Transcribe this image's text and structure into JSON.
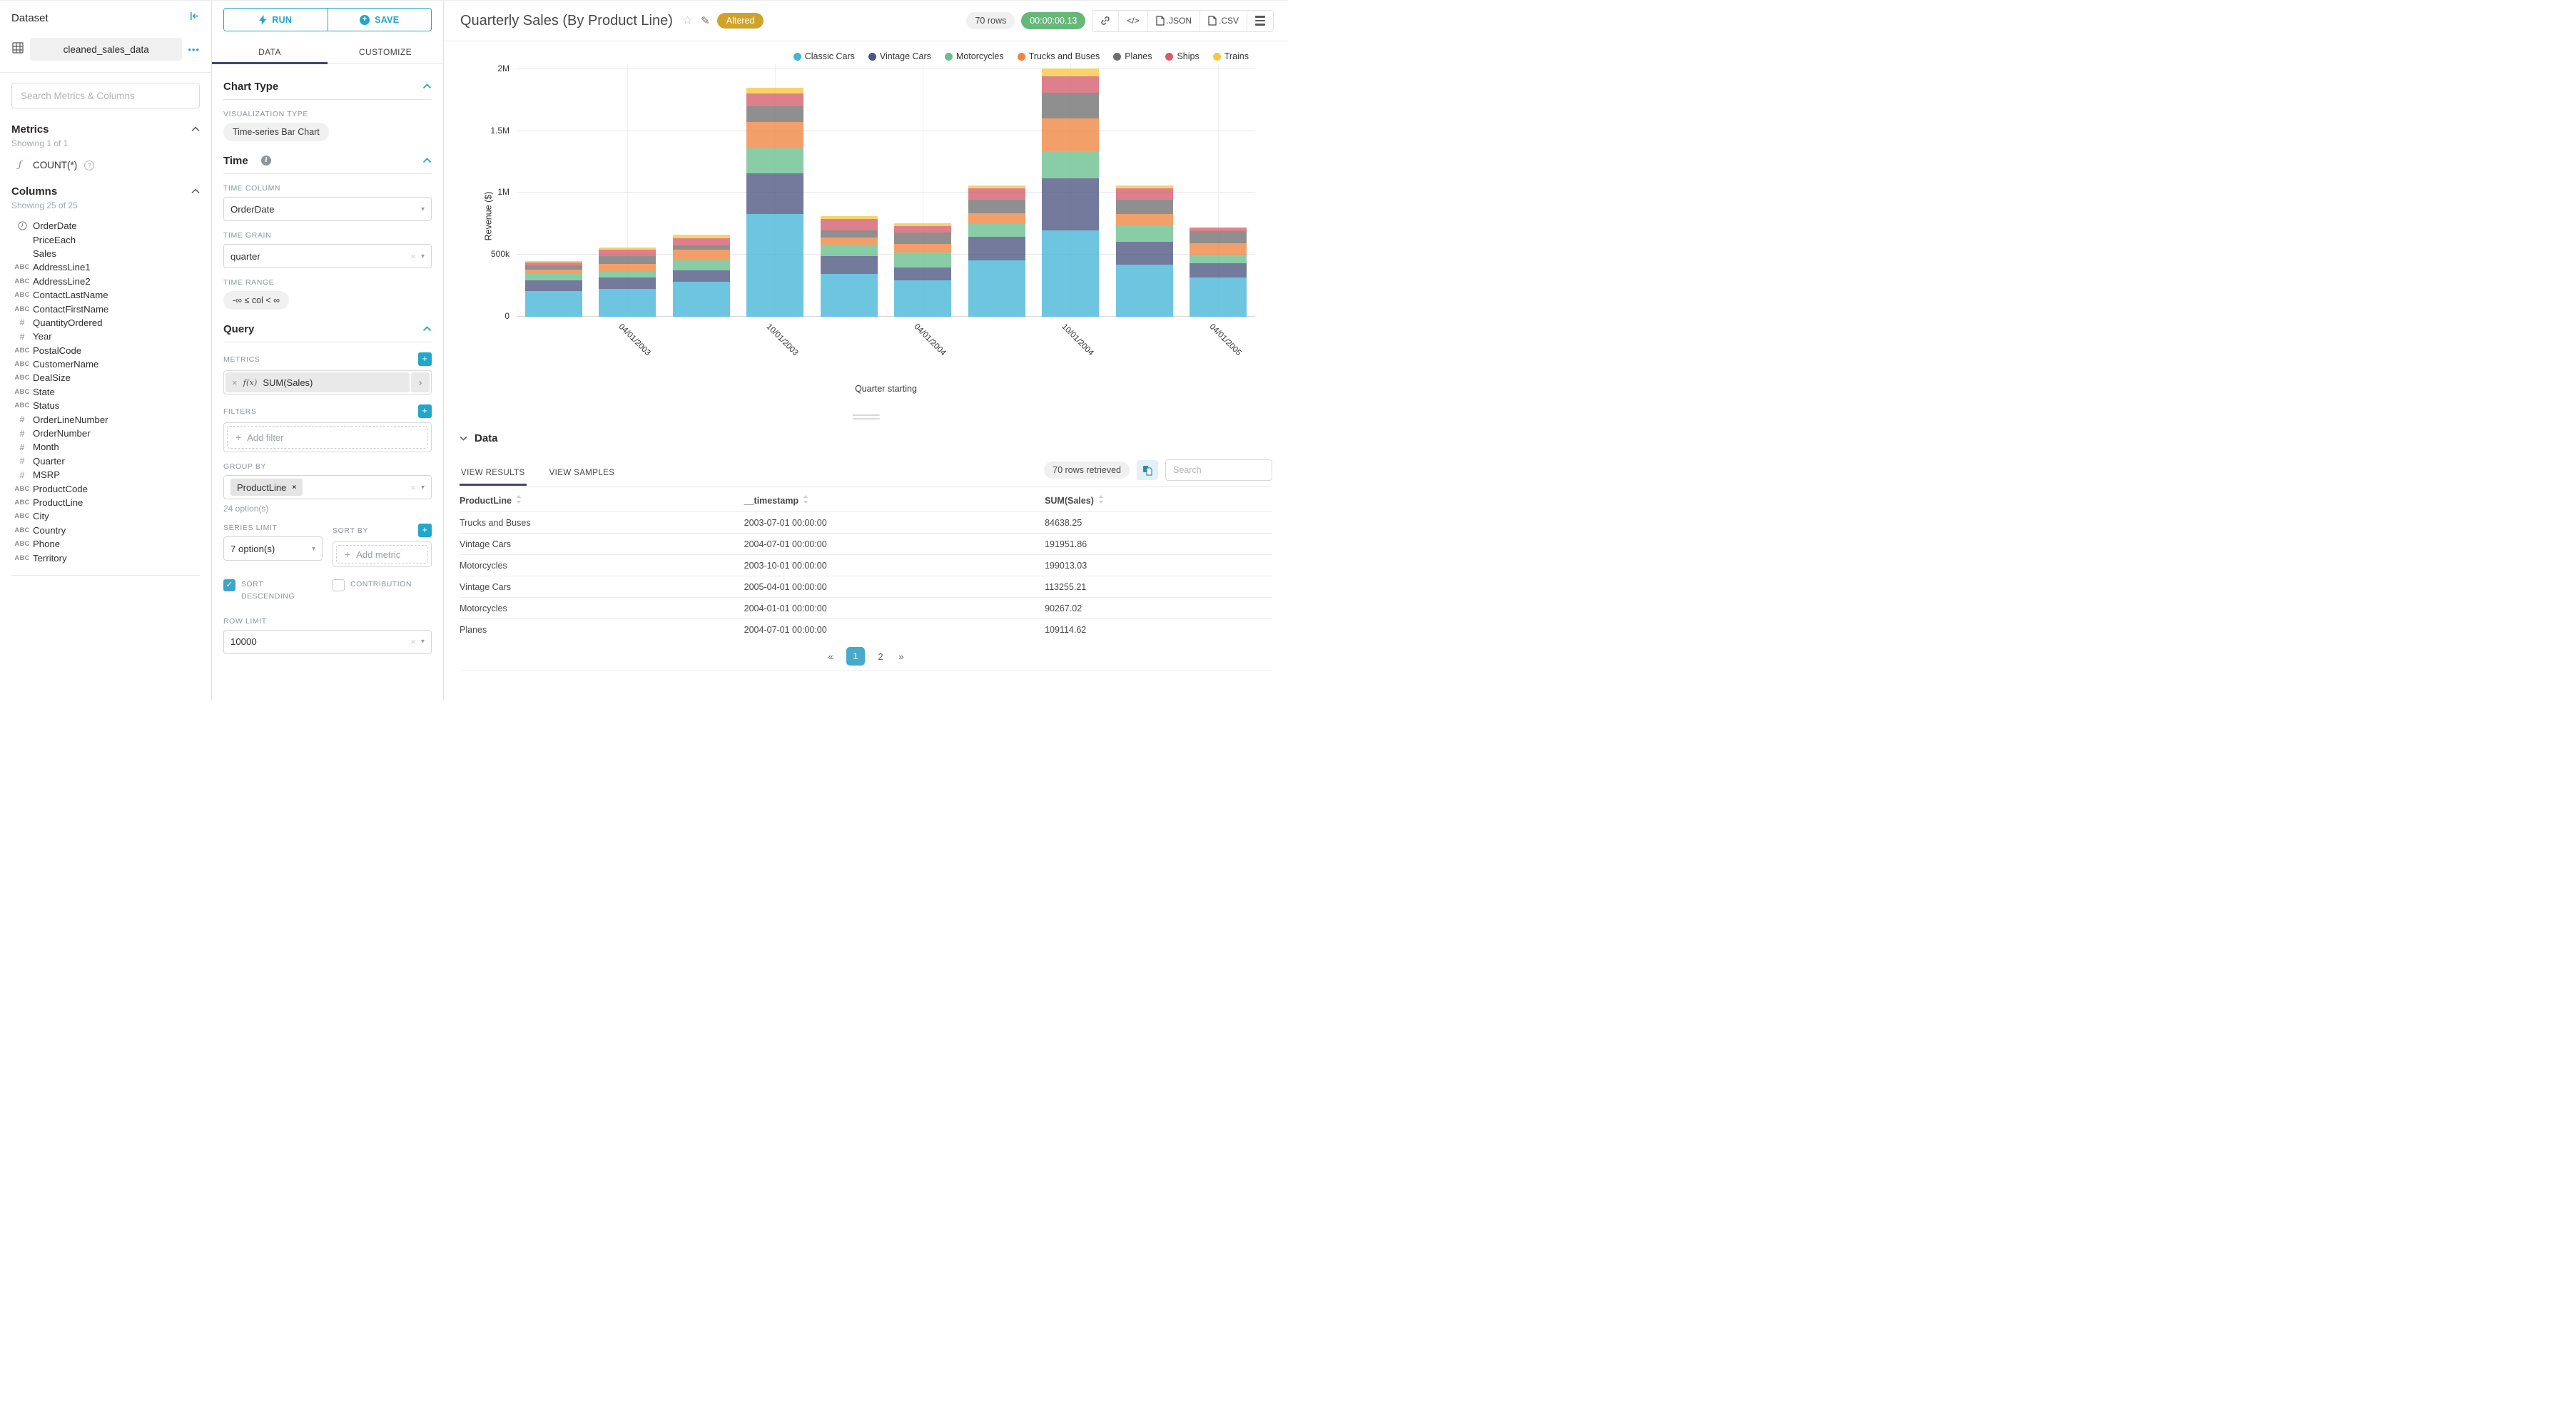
{
  "icons": {
    "caret": "▾",
    "clear": "×",
    "chevron_right": "›",
    "more": "•••",
    "star": "☆",
    "edit": "✎",
    "code": "</>",
    "prev": "«",
    "next": "»",
    "check": "✓",
    "plus": "+",
    "function": "ƒ",
    "fx": "f(x)",
    "help": "?",
    "info": "i"
  },
  "sidebar": {
    "title": "Dataset",
    "dataset_name": "cleaned_sales_data",
    "search_placeholder": "Search Metrics & Columns",
    "metrics": {
      "title": "Metrics",
      "showing": "Showing 1 of 1",
      "items": [
        {
          "icon": "function-icon",
          "label": "COUNT(*)"
        }
      ]
    },
    "columns": {
      "title": "Columns",
      "showing": "Showing 25 of 25",
      "items": [
        {
          "type": "time",
          "label": "OrderDate"
        },
        {
          "type": "none",
          "label": "PriceEach"
        },
        {
          "type": "none",
          "label": "Sales"
        },
        {
          "type": "text",
          "label": "AddressLine1"
        },
        {
          "type": "text",
          "label": "AddressLine2"
        },
        {
          "type": "text",
          "label": "ContactLastName"
        },
        {
          "type": "text",
          "label": "ContactFirstName"
        },
        {
          "type": "num",
          "label": "QuantityOrdered"
        },
        {
          "type": "num",
          "label": "Year"
        },
        {
          "type": "text",
          "label": "PostalCode"
        },
        {
          "type": "text",
          "label": "CustomerName"
        },
        {
          "type": "text",
          "label": "DealSize"
        },
        {
          "type": "text",
          "label": "State"
        },
        {
          "type": "text",
          "label": "Status"
        },
        {
          "type": "num",
          "label": "OrderLineNumber"
        },
        {
          "type": "num",
          "label": "OrderNumber"
        },
        {
          "type": "num",
          "label": "Month"
        },
        {
          "type": "num",
          "label": "Quarter"
        },
        {
          "type": "num",
          "label": "MSRP"
        },
        {
          "type": "text",
          "label": "ProductCode"
        },
        {
          "type": "text",
          "label": "ProductLine"
        },
        {
          "type": "text",
          "label": "City"
        },
        {
          "type": "text",
          "label": "Country"
        },
        {
          "type": "text",
          "label": "Phone"
        },
        {
          "type": "text",
          "label": "Territory"
        }
      ]
    }
  },
  "panel": {
    "run_label": "RUN",
    "save_label": "SAVE",
    "tabs": [
      "DATA",
      "CUSTOMIZE"
    ],
    "active_tab": "DATA",
    "chart_type": {
      "title": "Chart Type",
      "viz_label": "VISUALIZATION TYPE",
      "viz_value": "Time-series Bar Chart"
    },
    "time": {
      "title": "Time",
      "time_column_label": "TIME COLUMN",
      "time_column": "OrderDate",
      "time_grain_label": "TIME GRAIN",
      "time_grain": "quarter",
      "time_range_label": "TIME RANGE",
      "time_range": "-∞ ≤ col < ∞"
    },
    "query": {
      "title": "Query",
      "metrics_label": "METRICS",
      "metric_chip": "SUM(Sales)",
      "filters_label": "FILTERS",
      "add_filter": "Add filter",
      "group_by_label": "GROUP BY",
      "group_by_chip": "ProductLine",
      "group_by_hint": "24 option(s)",
      "series_limit_label": "SERIES LIMIT",
      "series_limit": "7 option(s)",
      "sort_by_label": "SORT BY",
      "add_metric": "Add metric",
      "sort_descending_label": "SORT DESCENDING",
      "contribution_label": "CONTRIBUTION",
      "row_limit_label": "ROW LIMIT",
      "row_limit": "10000"
    }
  },
  "header": {
    "title": "Quarterly Sales (By Product Line)",
    "badge": "Altered",
    "rows_pill": "70 rows",
    "timer_pill": "00:00:00.13",
    "export_json": ".JSON",
    "export_csv": ".CSV"
  },
  "chart_data": {
    "type": "bar",
    "stacked": true,
    "title": "Quarterly Sales (By Product Line)",
    "xlabel": "Quarter starting",
    "ylabel": "Revenue ($)",
    "grid": true,
    "legend_position": "top-right",
    "x": [
      "2003-01-01",
      "2003-04-01",
      "2003-07-01",
      "2003-10-01",
      "2004-01-01",
      "2004-04-01",
      "2004-07-01",
      "2004-10-01",
      "2005-01-01",
      "2005-04-01"
    ],
    "x_tick_labels": [
      "",
      "04/01/2003",
      "",
      "10/01/2003",
      "",
      "04/01/2004",
      "",
      "10/01/2004",
      "",
      "04/01/2005"
    ],
    "y_ticks": [
      {
        "v": 0,
        "label": "0"
      },
      {
        "v": 500000,
        "label": "500k"
      },
      {
        "v": 1000000,
        "label": "1M"
      },
      {
        "v": 1500000,
        "label": "1.5M"
      },
      {
        "v": 2000000,
        "label": "2M"
      }
    ],
    "ylim": [
      0,
      2040000
    ],
    "series": [
      {
        "name": "Classic Cars",
        "color": "#45b5d6",
        "values": [
          205000,
          226000,
          280000,
          830000,
          345000,
          295000,
          455000,
          700000,
          420000,
          320000
        ]
      },
      {
        "name": "Vintage Cars",
        "color": "#4c5480",
        "values": [
          88000,
          90000,
          95000,
          330000,
          145000,
          105000,
          191951.86,
          420000,
          185000,
          113255.21
        ]
      },
      {
        "name": "Motorcycles",
        "color": "#68bf8d",
        "values": [
          55000,
          45000,
          80000,
          199013.03,
          90267.02,
          120000,
          100000,
          215000,
          135000,
          67000
        ]
      },
      {
        "name": "Trucks and Buses",
        "color": "#f0843f",
        "values": [
          30000,
          65000,
          84638.25,
          215000,
          60000,
          70000,
          90000,
          265000,
          90000,
          92000
        ]
      },
      {
        "name": "Planes",
        "color": "#6f6f6f",
        "values": [
          35000,
          62000,
          35000,
          125000,
          55000,
          90000,
          109114.62,
          210000,
          115000,
          100000
        ]
      },
      {
        "name": "Ships",
        "color": "#d55b6b",
        "values": [
          25000,
          55000,
          60000,
          105000,
          95000,
          55000,
          90000,
          130000,
          90000,
          22000
        ]
      },
      {
        "name": "Trains",
        "color": "#f6c63f",
        "values": [
          10000,
          16000,
          28000,
          45000,
          25000,
          20000,
          25000,
          65000,
          25000,
          12000
        ]
      }
    ]
  },
  "data_panel": {
    "title": "Data",
    "tabs": [
      "VIEW RESULTS",
      "VIEW SAMPLES"
    ],
    "active_tab": "VIEW RESULTS",
    "rows_retrieved": "70 rows retrieved",
    "search_placeholder": "Search",
    "columns": [
      "ProductLine",
      "__timestamp",
      "SUM(Sales)"
    ],
    "rows": [
      [
        "Trucks and Buses",
        "2003-07-01 00:00:00",
        "84638.25"
      ],
      [
        "Vintage Cars",
        "2004-07-01 00:00:00",
        "191951.86"
      ],
      [
        "Motorcycles",
        "2003-10-01 00:00:00",
        "199013.03"
      ],
      [
        "Vintage Cars",
        "2005-04-01 00:00:00",
        "113255.21"
      ],
      [
        "Motorcycles",
        "2004-01-01 00:00:00",
        "90267.02"
      ],
      [
        "Planes",
        "2004-07-01 00:00:00",
        "109114.62"
      ]
    ],
    "pagination": {
      "prev": "«",
      "pages": [
        "1",
        "2"
      ],
      "active": "1",
      "next": "»"
    }
  }
}
